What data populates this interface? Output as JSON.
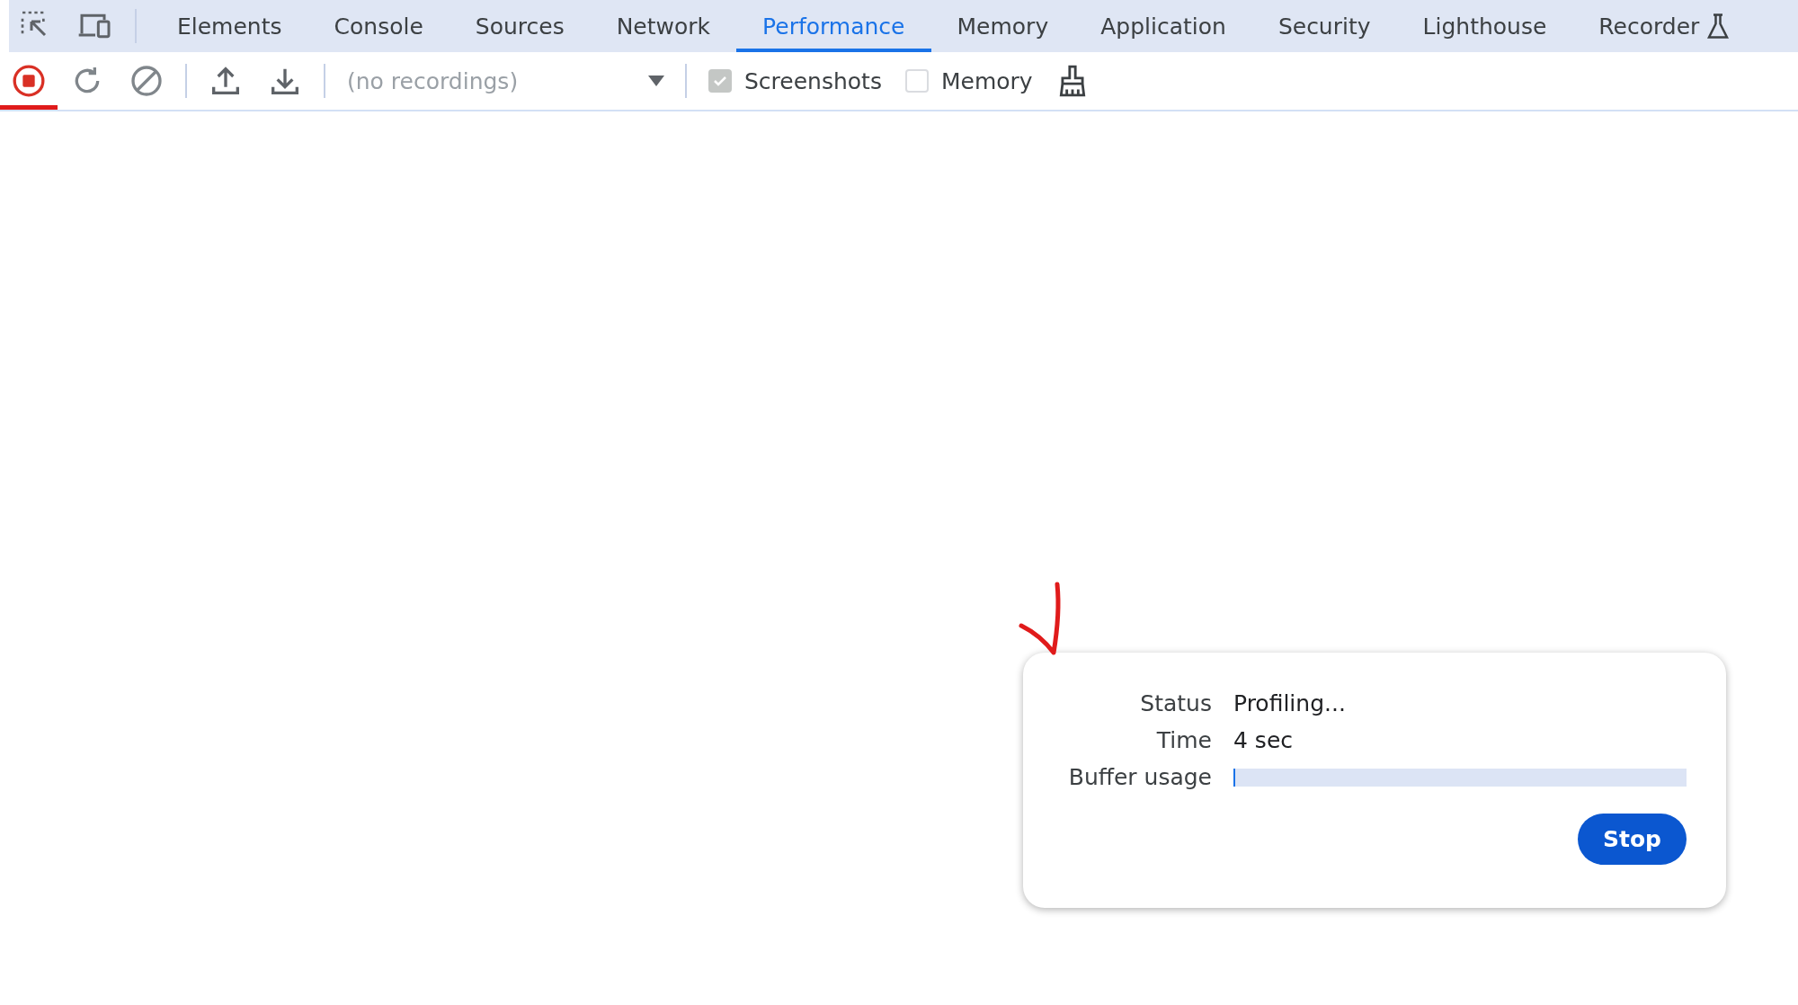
{
  "tabs": [
    {
      "label": "Elements",
      "selected": false
    },
    {
      "label": "Console",
      "selected": false
    },
    {
      "label": "Sources",
      "selected": false
    },
    {
      "label": "Network",
      "selected": false
    },
    {
      "label": "Performance",
      "selected": true
    },
    {
      "label": "Memory",
      "selected": false
    },
    {
      "label": "Application",
      "selected": false
    },
    {
      "label": "Security",
      "selected": false
    },
    {
      "label": "Lighthouse",
      "selected": false
    },
    {
      "label": "Recorder",
      "selected": false,
      "experimental": true
    }
  ],
  "toolbar": {
    "recording": true,
    "recordings_dropdown": {
      "value": "(no recordings)"
    },
    "options": [
      {
        "label": "Screenshots",
        "checked": true,
        "disabled": true
      },
      {
        "label": "Memory",
        "checked": false,
        "disabled": false
      }
    ]
  },
  "status_dialog": {
    "rows": [
      {
        "label": "Status",
        "value": "Profiling..."
      },
      {
        "label": "Time",
        "value": "4 sec"
      }
    ],
    "buffer": {
      "label": "Buffer usage",
      "level": 0.004
    },
    "button": "Stop"
  }
}
